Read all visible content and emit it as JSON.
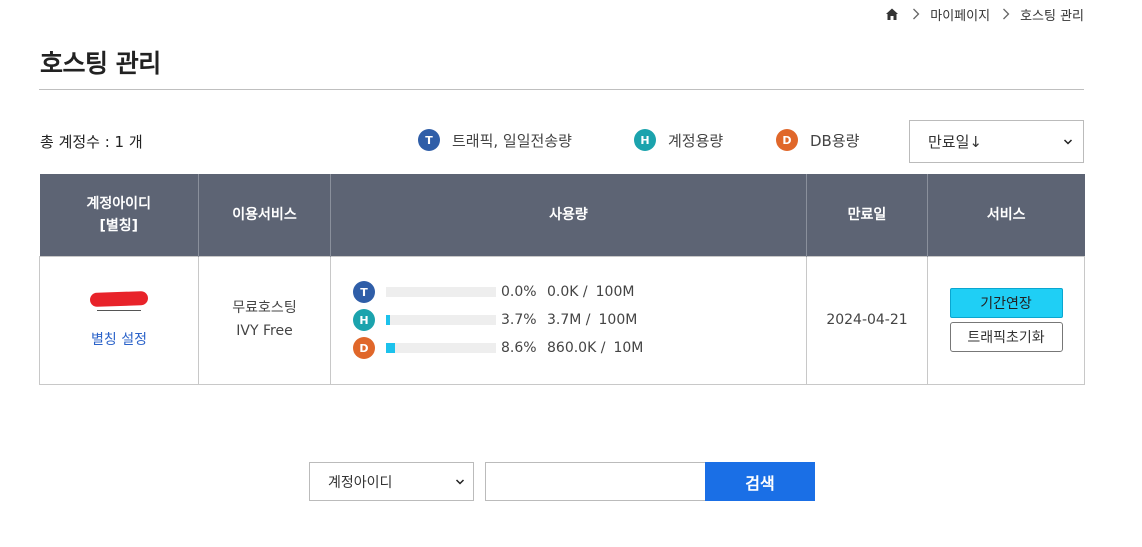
{
  "breadcrumb": {
    "items": [
      "마이페이지",
      "호스팅 관리"
    ]
  },
  "page": {
    "title": "호스팅 관리"
  },
  "summary": {
    "total_accounts": "총 계정수 : 1 개"
  },
  "legend": [
    {
      "badge": "T",
      "label": "트래픽, 일일전송량",
      "color": "#2f5ea8"
    },
    {
      "badge": "H",
      "label": "계정용량",
      "color": "#1ba3ad"
    },
    {
      "badge": "D",
      "label": "DB용량",
      "color": "#e0672a"
    }
  ],
  "sort": {
    "selected": "만료일↓"
  },
  "table": {
    "headers": [
      "계정아이디",
      "[별칭]",
      "이용서비스",
      "사용량",
      "만료일",
      "서비스"
    ],
    "rows": [
      {
        "alias_link": "별칭 설정",
        "service_line1": "무료호스팅",
        "service_line2": "IVY Free",
        "usage": [
          {
            "badge": "T",
            "percent": 0.0,
            "pct_text": "0.0%",
            "used": "0.0K /",
            "limit": "100M"
          },
          {
            "badge": "H",
            "percent": 3.7,
            "pct_text": "3.7%",
            "used": "3.7M /",
            "limit": "100M"
          },
          {
            "badge": "D",
            "percent": 8.6,
            "pct_text": "8.6%",
            "used": "860.0K /",
            "limit": "10M"
          }
        ],
        "expires": "2024-04-21",
        "buttons": {
          "extend": "기간연장",
          "reset_traffic": "트래픽초기화"
        }
      }
    ]
  },
  "search": {
    "field_selected": "계정아이디",
    "query": "",
    "button": "검색"
  },
  "colors": {
    "header_bg": "#5d6474",
    "accent": "#1a6fe6",
    "bar": "#1cc2ec",
    "extend_btn": "#1fcff5",
    "link": "#2a62c9"
  }
}
